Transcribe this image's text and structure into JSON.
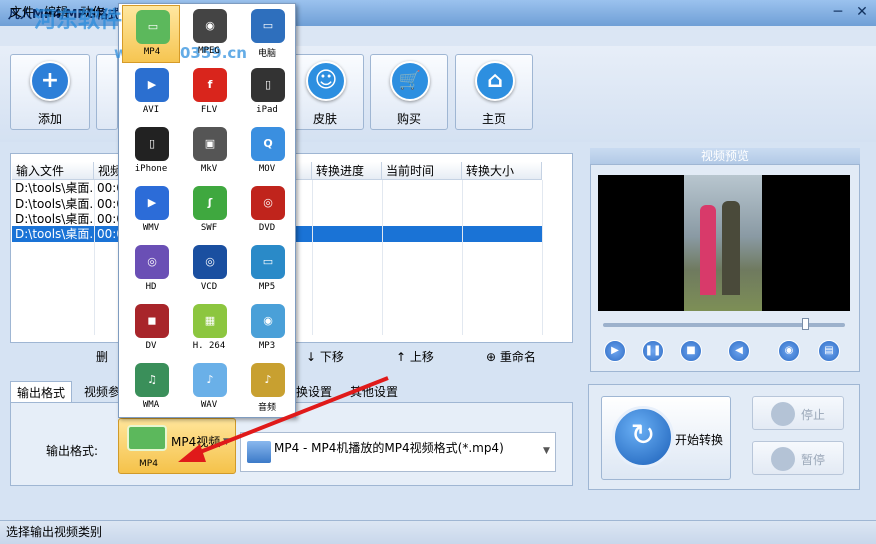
{
  "window": {
    "title": "凡人MP4/MPG格式转",
    "watermark": "河东软件园",
    "watermark_url": "www.pc0359.cn",
    "minimize": "─",
    "close": "✕"
  },
  "menu": [
    "文件",
    "编辑",
    "动作",
    "帮助"
  ],
  "toolbar": [
    {
      "label": "添加",
      "icon": "plus-icon",
      "color": "#2d7fd8",
      "glyph": "+"
    },
    {
      "label": "皮肤",
      "icon": "smiley-icon",
      "color": "#2d8fe0",
      "glyph": "☺"
    },
    {
      "label": "购买",
      "icon": "cart-icon",
      "color": "#2d8fe0",
      "glyph": "🛒"
    },
    {
      "label": "主页",
      "icon": "home-icon",
      "color": "#2d8fe0",
      "glyph": "⌂"
    }
  ],
  "file_list": {
    "columns": [
      "输入文件",
      "视频",
      "转换进度",
      "当前时间",
      "转换大小"
    ],
    "rows": [
      {
        "file": "D:\\tools\\桌面...",
        "time": "00:0"
      },
      {
        "file": "D:\\tools\\桌面...",
        "time": "00:0"
      },
      {
        "file": "D:\\tools\\桌面...",
        "time": "00:0"
      },
      {
        "file": "D:\\tools\\桌面...",
        "time": "00:0"
      }
    ]
  },
  "actions": {
    "delete": "删",
    "down": "↓ 下移",
    "up": "↑ 上移",
    "rename": "⊕ 重命名"
  },
  "tabs": [
    "输出格式",
    "视频参",
    "换设置",
    "其他设置"
  ],
  "output": {
    "label": "输出格式:",
    "format_button": "MP4视频",
    "format_sub": "MP4",
    "format_desc": "MP4 - MP4机播放的MP4视频格式(*.mp4)"
  },
  "preview": {
    "title": "视频预览"
  },
  "convert": {
    "start": "开始转换",
    "stop": "停止",
    "pause": "暂停"
  },
  "status": "选择输出视频类别",
  "formats": [
    {
      "label": "MP4",
      "color": "#5cb85c",
      "glyph": "▭",
      "selected": true
    },
    {
      "label": "MPEG",
      "color": "#444",
      "glyph": "◉"
    },
    {
      "label": "电脑",
      "color": "#2e6fbd",
      "glyph": "▭"
    },
    {
      "label": "AVI",
      "color": "#2b6fd0",
      "glyph": "▶"
    },
    {
      "label": "FLV",
      "color": "#d9251c",
      "glyph": "f"
    },
    {
      "label": "iPad",
      "color": "#333",
      "glyph": "▯"
    },
    {
      "label": "iPhone",
      "color": "#222",
      "glyph": "▯"
    },
    {
      "label": "MkV",
      "color": "#555",
      "glyph": "▣"
    },
    {
      "label": "MOV",
      "color": "#3a8fe0",
      "glyph": "Q"
    },
    {
      "label": "WMV",
      "color": "#2c6cd8",
      "glyph": "▶"
    },
    {
      "label": "SWF",
      "color": "#3fa83f",
      "glyph": "ʃ"
    },
    {
      "label": "DVD",
      "color": "#c0241c",
      "glyph": "◎"
    },
    {
      "label": "HD",
      "color": "#6a4fb5",
      "glyph": "◎"
    },
    {
      "label": "VCD",
      "color": "#1a4fa0",
      "glyph": "◎"
    },
    {
      "label": "MP5",
      "color": "#2a8ac8",
      "glyph": "▭"
    },
    {
      "label": "DV",
      "color": "#a8252a",
      "glyph": "◼"
    },
    {
      "label": "H. 264",
      "color": "#8cc63f",
      "glyph": "▦"
    },
    {
      "label": "MP3",
      "color": "#4aa0d8",
      "glyph": "◉"
    },
    {
      "label": "WMA",
      "color": "#3a8f5a",
      "glyph": "♫"
    },
    {
      "label": "WAV",
      "color": "#6ab0e8",
      "glyph": "♪"
    },
    {
      "label": "音频",
      "color": "#c8a030",
      "glyph": "♪"
    }
  ]
}
